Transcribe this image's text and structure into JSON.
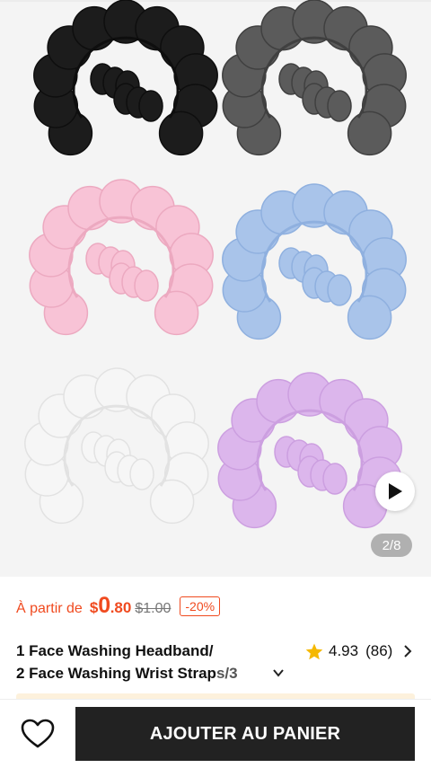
{
  "gallery": {
    "counter": "2/8",
    "play_icon": "play-icon",
    "variants": [
      {
        "name": "black",
        "color": "#1c1c1c",
        "shade": "#0e0e0e"
      },
      {
        "name": "grey",
        "color": "#5b5b5b",
        "shade": "#404040"
      },
      {
        "name": "pink",
        "color": "#f8c3d6",
        "shade": "#eca9c0"
      },
      {
        "name": "blue",
        "color": "#a9c4ea",
        "shade": "#8fb0df"
      },
      {
        "name": "white",
        "color": "#f6f6f6",
        "shade": "#e2e2e2"
      },
      {
        "name": "lilac",
        "color": "#dcb6ec",
        "shade": "#cc9fe0"
      }
    ]
  },
  "price": {
    "from_label": "À partir de",
    "currency": "$",
    "main": "0",
    "cents": ".80",
    "old": "$1.00",
    "discount": "-20%"
  },
  "product": {
    "title_line1": "1 Face Washing Headband/",
    "title_line2": "2 Face Washing Wrist Strap",
    "title_fade": "s/3",
    "rating": "4.93",
    "reviews": "(86)"
  },
  "bottom": {
    "add_to_cart": "AJOUTER AU PANIER"
  },
  "colors": {
    "accent": "#f04a1f",
    "star": "#f5b800",
    "button": "#222222"
  }
}
